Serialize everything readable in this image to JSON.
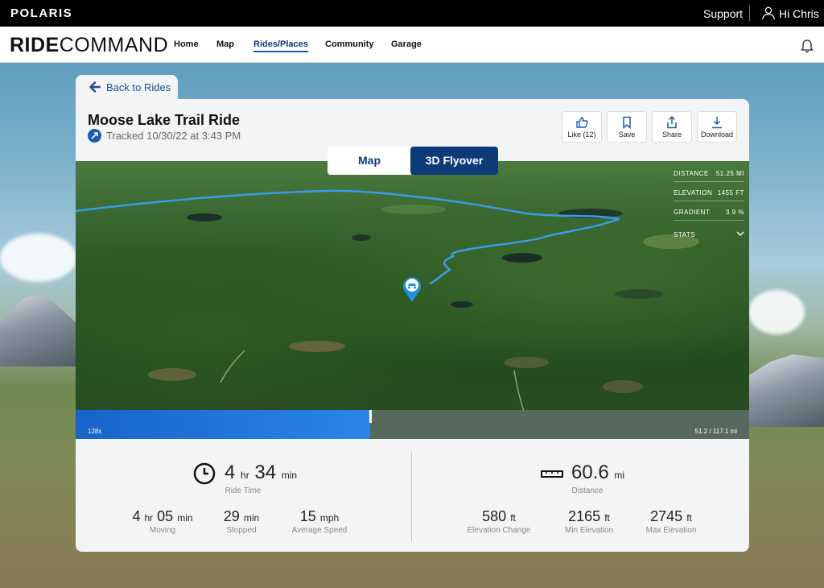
{
  "topbar": {
    "brand": "POLARIS",
    "support": "Support",
    "greeting": "Hi Chris"
  },
  "nav": {
    "brand_bold": "RIDE",
    "brand_light": "COMMAND",
    "items": [
      "Home",
      "Map",
      "Rides/Places",
      "Community",
      "Garage"
    ],
    "active": "Rides/Places"
  },
  "back": {
    "label": "Back to Rides"
  },
  "ride": {
    "title": "Moose Lake Trail Ride",
    "tracked": "Tracked 10/30/22 at 3:43 PM"
  },
  "actions": [
    {
      "label": "Like (12)",
      "icon": "thumbs-up-icon"
    },
    {
      "label": "Save",
      "icon": "bookmark-icon"
    },
    {
      "label": "Share",
      "icon": "share-icon"
    },
    {
      "label": "Download",
      "icon": "download-icon"
    }
  ],
  "view_toggle": {
    "map": "Map",
    "flyover": "3D Flyover",
    "selected": "3D Flyover"
  },
  "overlay_stats": {
    "distance_label": "DISTANCE",
    "distance_value": "51.25 MI",
    "elevation_label": "ELEVATION",
    "elevation_value": "1455 FT",
    "gradient_label": "GRADIENT",
    "gradient_value": "3.9 %",
    "stats_label": "STATS"
  },
  "timeline": {
    "speed": "128x",
    "position": "51.2 / 117.1 mi",
    "progress": 0.437
  },
  "summary": {
    "ride_time": {
      "hr": "4",
      "hr_unit": "hr",
      "min": "34",
      "min_unit": "min",
      "label": "Ride Time"
    },
    "distance": {
      "value": "60.6",
      "unit": "mi",
      "label": "Distance"
    },
    "moving": {
      "hr": "4",
      "hr_unit": "hr",
      "min": "05",
      "min_unit": "min",
      "label": "Moving"
    },
    "stopped": {
      "value": "29",
      "unit": "min",
      "label": "Stopped"
    },
    "avg_speed": {
      "value": "15",
      "unit": "mph",
      "label": "Average Speed"
    },
    "elev_change": {
      "value": "580",
      "unit": "ft",
      "label": "Elevation Change"
    },
    "min_elev": {
      "value": "2165",
      "unit": "ft",
      "label": "Min Elevation"
    },
    "max_elev": {
      "value": "2745",
      "unit": "ft",
      "label": "Max Elevation"
    }
  },
  "colors": {
    "navy": "#0d3a78",
    "route": "#3a9be8",
    "timeline": "#1e74d8"
  }
}
